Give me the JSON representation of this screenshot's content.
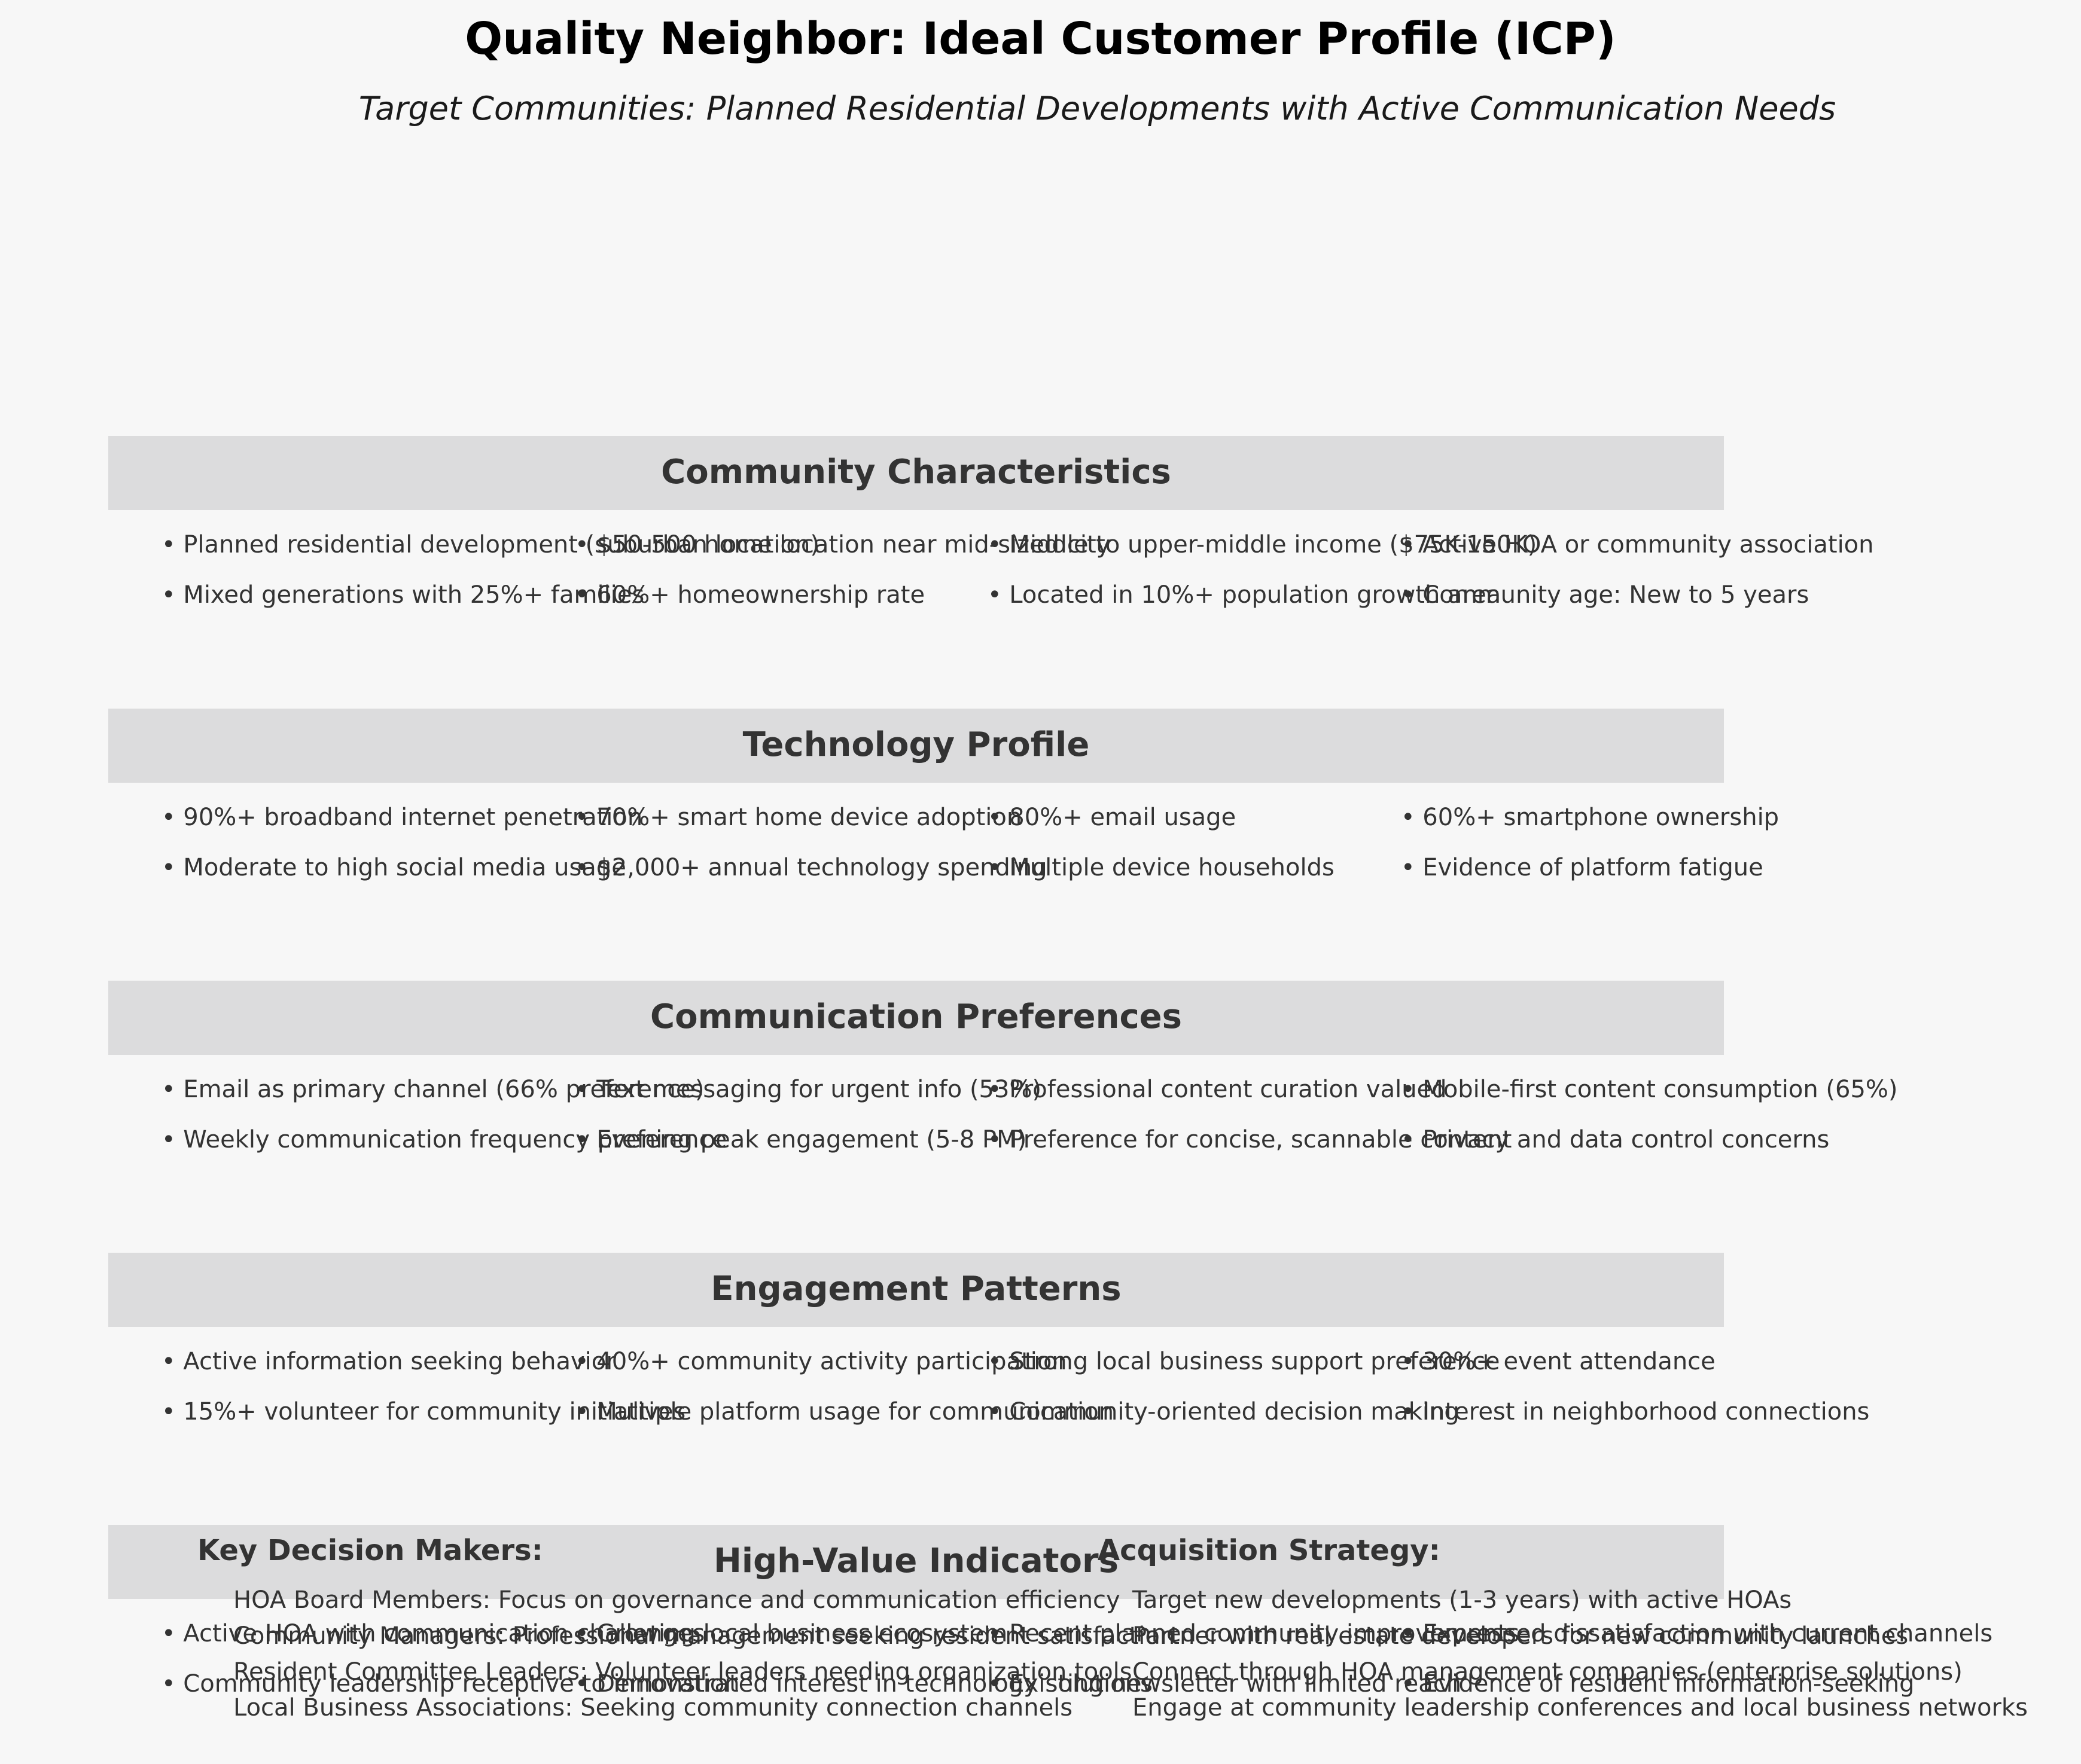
{
  "title": "Quality Neighbor: Ideal Customer Profile (ICP)",
  "subtitle": "Target Communities: Planned Residential Developments with Active Communication Needs",
  "sections": [
    {
      "title": "Community Characteristics",
      "bullets": [
        "• Planned residential development (suburban location)",
        "• $50-500 home location near mid-sized city",
        "• Middle to upper-middle income ($75K-150K)",
        "• Active HOA or community association",
        "• Mixed generations with 25%+ families",
        "• 60%+ homeownership rate",
        "• Located in 10%+ population growth area",
        "• Community age: New to 5 years"
      ]
    },
    {
      "title": "Technology Profile",
      "bullets": [
        "• 90%+ broadband internet penetration",
        "• 70%+ smart home device adoption",
        "• 80%+ email usage",
        "• 60%+ smartphone ownership",
        "• Moderate to high social media usage",
        "• $2,000+ annual technology spending",
        "• Multiple device households",
        "• Evidence of platform fatigue"
      ]
    },
    {
      "title": "Communication Preferences",
      "bullets": [
        "• Email as primary channel (66% preference)",
        "• Text messaging for urgent info (53%)",
        "• Professional content curation valued",
        "• Mobile-first content consumption (65%)",
        "• Weekly communication frequency preference",
        "• Evening peak engagement (5-8 PM)",
        "• Preference for concise, scannable content",
        "• Privacy and data control concerns"
      ]
    },
    {
      "title": "Engagement Patterns",
      "bullets": [
        "• Active information seeking behavior",
        "• 40%+ community activity participation",
        "• Strong local business support preference",
        "• 30%+ event attendance",
        "• 15%+ volunteer for community initiatives",
        "• Multiple platform usage for communication",
        "• Community-oriented decision making",
        "• Interest in neighborhood connections"
      ]
    },
    {
      "title": "High-Value Indicators",
      "bullets": [
        "• Active HOA with communication challenges",
        "• Growing local business ecosystem",
        "• Recent planned community improvements",
        "• Expressed dissatisfaction with current channels",
        "• Community leadership receptive to innovation",
        "• Demonstrated interest in technology solutions",
        "• Existing newsletter with limited reach",
        "• Evidence of resident information-seeking"
      ]
    }
  ],
  "decision_makers": {
    "title": "Key Decision Makers:",
    "items": [
      "HOA Board Members: Focus on governance and communication efficiency",
      "Community Managers: Professional management seeking resident satisfaction",
      "Resident Committee Leaders: Volunteer leaders needing organization tools",
      "Local Business Associations: Seeking community connection channels"
    ]
  },
  "acquisition": {
    "title": "Acquisition Strategy:",
    "items": [
      "Target new developments (1-3 years) with active HOAs",
      "Partner with real estate developers for new community launches",
      "Connect through HOA management companies (enterprise solutions)",
      "Engage at community leadership conferences and local business networks"
    ]
  }
}
